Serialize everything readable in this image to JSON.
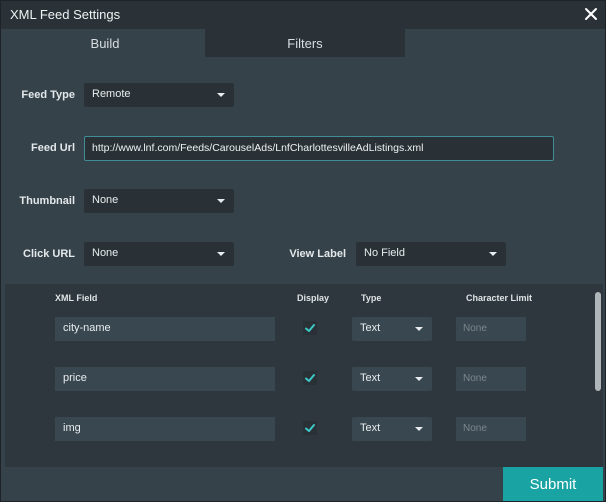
{
  "dialog": {
    "title": "XML Feed Settings",
    "close_icon": "close-icon"
  },
  "tabs": [
    {
      "label": "Build",
      "active": true
    },
    {
      "label": "Filters",
      "active": false
    }
  ],
  "form": {
    "feed_type": {
      "label": "Feed Type",
      "value": "Remote"
    },
    "feed_url": {
      "label": "Feed Url",
      "value": "http://www.lnf.com/Feeds/CarouselAds/LnfCharlottesvilleAdListings.xml"
    },
    "thumbnail": {
      "label": "Thumbnail",
      "value": "None"
    },
    "click_url": {
      "label": "Click URL",
      "value": "None"
    },
    "view_label": {
      "label": "View Label",
      "value": "No Field"
    }
  },
  "table": {
    "headers": {
      "xml_field": "XML Field",
      "display": "Display",
      "type": "Type",
      "char_limit": "Character Limit"
    },
    "rows": [
      {
        "field": "city-name",
        "display": true,
        "type": "Text",
        "limit_placeholder": "None"
      },
      {
        "field": "price",
        "display": true,
        "type": "Text",
        "limit_placeholder": "None"
      },
      {
        "field": "img",
        "display": true,
        "type": "Text",
        "limit_placeholder": "None"
      }
    ]
  },
  "footer": {
    "submit_label": "Submit"
  },
  "colors": {
    "accent": "#1aa3a3",
    "check": "#3ec8c8",
    "panel": "#36424a",
    "titlebar": "#2b3237"
  }
}
